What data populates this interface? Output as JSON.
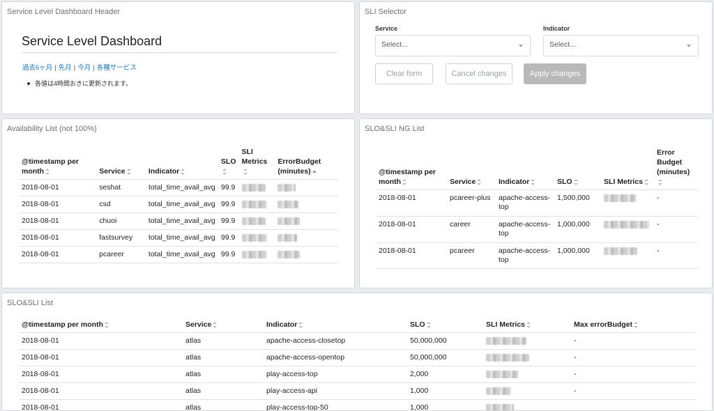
{
  "header": {
    "panel_title": "Service Level Dashboard Header",
    "title": "Service Level Dashboard",
    "links": [
      "過去6ヶ月",
      "先月",
      "今月",
      "各種サービス"
    ],
    "note": "各値は4時間おきに更新されます。"
  },
  "selector": {
    "panel_title": "SLI Selector",
    "service_label": "Service",
    "service_placeholder": "Select...",
    "indicator_label": "Indicator",
    "indicator_placeholder": "Select...",
    "clear_label": "Clear form",
    "cancel_label": "Cancel changes",
    "apply_label": "Apply changes"
  },
  "availability": {
    "panel_title": "Availability List (not 100%)",
    "columns": [
      "@timestamp per month",
      "Service",
      "Indicator",
      "SLO",
      "SLI Metrics",
      "ErrorBudget (minutes)"
    ],
    "rows": [
      [
        "2018-08-01",
        "seshat",
        "total_time_avail_avg",
        "99.9"
      ],
      [
        "2018-08-01",
        "csd",
        "total_time_avail_avg",
        "99.9"
      ],
      [
        "2018-08-01",
        "chuoi",
        "total_time_avail_avg",
        "99.9"
      ],
      [
        "2018-08-01",
        "fastsurvey",
        "total_time_avail_avg",
        "99.9"
      ],
      [
        "2018-08-01",
        "pcareer",
        "total_time_avail_avg",
        "99.9"
      ]
    ]
  },
  "ng": {
    "panel_title": "SLO&SLI NG List",
    "columns": [
      "@timestamp per month",
      "Service",
      "Indicator",
      "SLO",
      "SLI Metrics",
      "Error Budget (minutes)"
    ],
    "rows": [
      [
        "2018-08-01",
        "pcareer-plus",
        "apache-access-top",
        "1,500,000",
        "-"
      ],
      [
        "2018-08-01",
        "career",
        "apache-access-top",
        "1,000,000",
        "-"
      ],
      [
        "2018-08-01",
        "pcareer",
        "apache-access-top",
        "1,000,000",
        "-"
      ]
    ]
  },
  "list": {
    "panel_title": "SLO&SLI List",
    "columns": [
      "@timestamp per month",
      "Service",
      "Indicator",
      "SLO",
      "SLI Metrics",
      "Max errorBudget"
    ],
    "rows": [
      [
        "2018-08-01",
        "atlas",
        "apache-access-closetop",
        "50,000,000",
        "-"
      ],
      [
        "2018-08-01",
        "atlas",
        "apache-access-opentop",
        "50,000,000",
        "-"
      ],
      [
        "2018-08-01",
        "atlas",
        "play-access-top",
        "2,000",
        "-"
      ],
      [
        "2018-08-01",
        "atlas",
        "play-access-api",
        "1,000",
        "-"
      ],
      [
        "2018-08-01",
        "atlas",
        "play-access-top-50",
        "1,000",
        ""
      ]
    ]
  }
}
